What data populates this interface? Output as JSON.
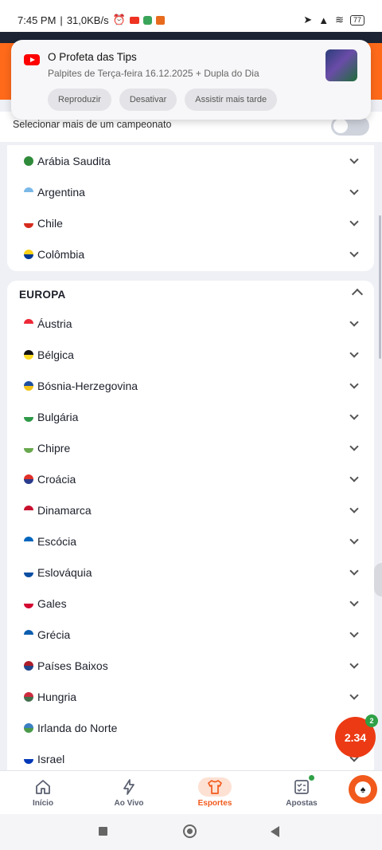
{
  "status_bar": {
    "time": "7:45 PM",
    "speed": "31,0KB/s",
    "battery": "77"
  },
  "notification": {
    "title": "O Profeta das Tips",
    "subtitle": "Palpites de Terça-feira 16.12.2025 + Dupla do Dia",
    "actions": [
      "Reproduzir",
      "Desativar",
      "Assistir mais tarde"
    ]
  },
  "selector": {
    "label": "Selecionar mais de um campeonato"
  },
  "americas_items": [
    {
      "name": "Arábia Saudita",
      "flag": [
        "#2f8b3a",
        "#2f8b3a"
      ]
    },
    {
      "name": "Argentina",
      "flag": [
        "#7ab8e8",
        "#ffffff"
      ]
    },
    {
      "name": "Chile",
      "flag": [
        "#ffffff",
        "#d52b1e"
      ]
    },
    {
      "name": "Colômbia",
      "flag": [
        "#fcd116",
        "#003893"
      ]
    }
  ],
  "europe": {
    "title": "EUROPA",
    "items": [
      {
        "name": "Áustria",
        "flag": [
          "#ed2939",
          "#ffffff"
        ]
      },
      {
        "name": "Bélgica",
        "flag": [
          "#111111",
          "#fdda24"
        ]
      },
      {
        "name": "Bósnia-Herzegovina",
        "flag": [
          "#1e4fa0",
          "#f3c318"
        ]
      },
      {
        "name": "Bulgária",
        "flag": [
          "#ffffff",
          "#2e9948"
        ]
      },
      {
        "name": "Chipre",
        "flag": [
          "#ffffff",
          "#69a84f"
        ]
      },
      {
        "name": "Croácia",
        "flag": [
          "#e03028",
          "#2b3b8c"
        ]
      },
      {
        "name": "Dinamarca",
        "flag": [
          "#c8102e",
          "#ffffff"
        ]
      },
      {
        "name": "Escócia",
        "flag": [
          "#0065bd",
          "#ffffff"
        ]
      },
      {
        "name": "Eslováquia",
        "flag": [
          "#ffffff",
          "#0b4ea2"
        ]
      },
      {
        "name": "Gales",
        "flag": [
          "#ffffff",
          "#d30731"
        ]
      },
      {
        "name": "Grécia",
        "flag": [
          "#0d5eaf",
          "#ffffff"
        ]
      },
      {
        "name": "Países Baixos",
        "flag": [
          "#ae1c28",
          "#21468b"
        ]
      },
      {
        "name": "Hungria",
        "flag": [
          "#cd2a3e",
          "#436f4d"
        ]
      },
      {
        "name": "Irlanda do Norte",
        "flag": [
          "#3a7fc2",
          "#4b9a4b"
        ]
      },
      {
        "name": "Israel",
        "flag": [
          "#ffffff",
          "#0038b8"
        ]
      }
    ]
  },
  "odds_bubble": {
    "value": "2.34",
    "badge": "2"
  },
  "bottom_nav": [
    {
      "label": "Início",
      "icon": "home-icon"
    },
    {
      "label": "Ao Vivo",
      "icon": "bolt-icon"
    },
    {
      "label": "Esportes",
      "icon": "shirt-icon",
      "active": true
    },
    {
      "label": "Apostas",
      "icon": "betslip-icon"
    }
  ],
  "colors": {
    "accent": "#f15a1c",
    "bubble": "#ec3a14",
    "badge": "#2fa046"
  }
}
